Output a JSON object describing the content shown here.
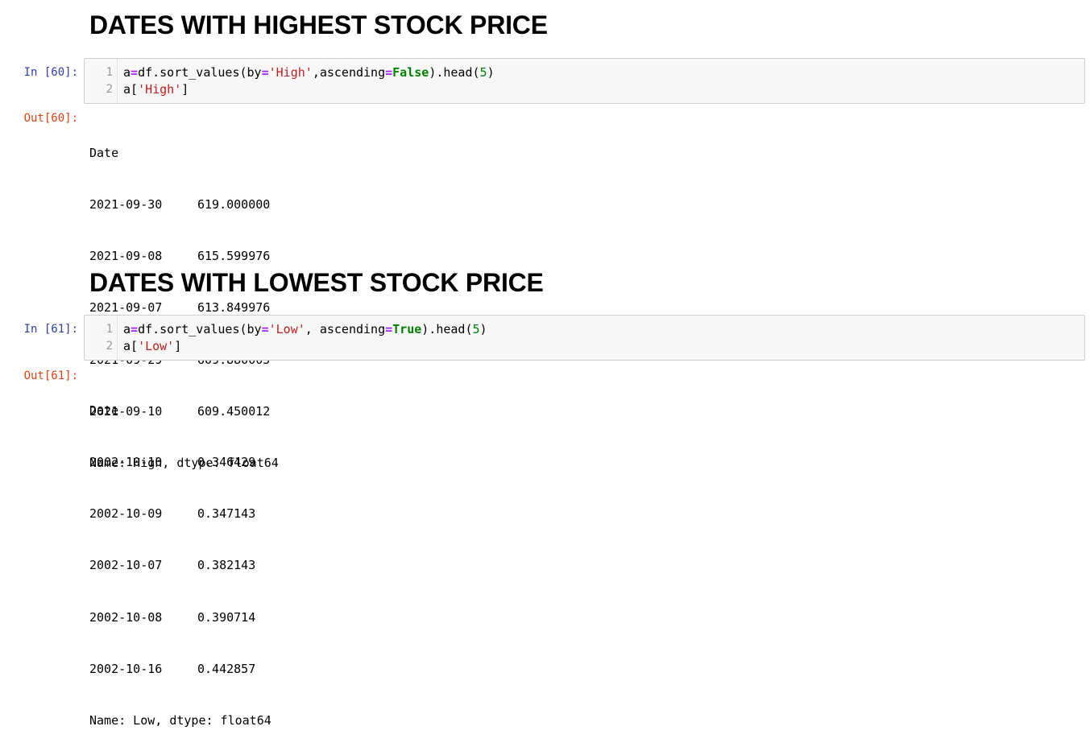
{
  "sections": [
    {
      "heading": "DATES WITH HIGHEST STOCK PRICE",
      "in_prompt": "In [60]:",
      "out_prompt": "Out[60]:",
      "code_lines": [
        [
          "1",
          "a",
          "=",
          "df.sort_values(by",
          "=",
          "'High'",
          ",ascending",
          "=",
          "False",
          ").head(",
          "5",
          ")"
        ],
        [
          "2",
          "a[",
          "'High'",
          "]"
        ]
      ],
      "output": {
        "index_name": "Date",
        "rows": [
          {
            "date": "2021-09-30",
            "value": "619.000000"
          },
          {
            "date": "2021-09-08",
            "value": "615.599976"
          },
          {
            "date": "2021-09-07",
            "value": "613.849976"
          },
          {
            "date": "2021-09-29",
            "value": "609.880005"
          },
          {
            "date": "2021-09-10",
            "value": "609.450012"
          }
        ],
        "footer": "Name: High, dtype: float64"
      }
    },
    {
      "heading": "DATES WITH LOWEST STOCK PRICE",
      "in_prompt": "In [61]:",
      "out_prompt": "Out[61]:",
      "code_lines": [
        [
          "1",
          "a",
          "=",
          "df.sort_values(by",
          "=",
          "'Low'",
          ", ascending",
          "=",
          "True",
          ").head(",
          "5",
          ")"
        ],
        [
          "2",
          "a[",
          "'Low'",
          "]"
        ]
      ],
      "output": {
        "index_name": "Date",
        "rows": [
          {
            "date": "2002-10-10",
            "value": "0.346429"
          },
          {
            "date": "2002-10-09",
            "value": "0.347143"
          },
          {
            "date": "2002-10-07",
            "value": "0.382143"
          },
          {
            "date": "2002-10-08",
            "value": "0.390714"
          },
          {
            "date": "2002-10-16",
            "value": "0.442857"
          }
        ],
        "footer": "Name: Low, dtype: float64"
      }
    }
  ],
  "colors": {
    "in_prompt": "#303f9f",
    "out_prompt": "#d84315",
    "string": "#ba2121",
    "keyword": "#008000",
    "operator": "#aa22ff",
    "cell_background": "#f7f7f7"
  }
}
